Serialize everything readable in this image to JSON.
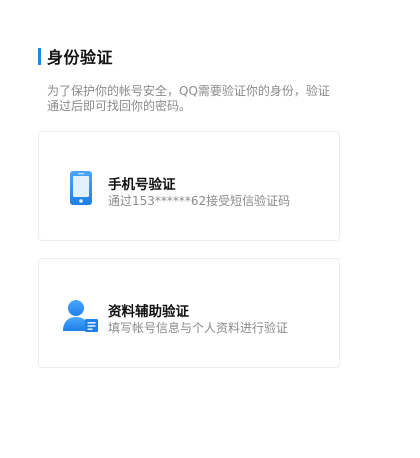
{
  "header": {
    "title": "身份验证",
    "accent_color": "#1e88e5"
  },
  "description": {
    "line1": "为了保护你的帐号安全，QQ需要验证你的身份，验证",
    "line2": "通过后即可找回你的密码。"
  },
  "options": [
    {
      "title": "手机号验证",
      "subtitle": "通过153******62接受短信验证码",
      "icon": "mobile-phone-icon"
    },
    {
      "title": "资料辅助验证",
      "subtitle": "填写帐号信息与个人资料进行验证",
      "icon": "user-profile-icon"
    }
  ],
  "colors": {
    "title_text": "#111111",
    "secondary_text": "#8a8a8a",
    "card_border": "#ececec",
    "icon_blue": "#2b8ef0"
  }
}
